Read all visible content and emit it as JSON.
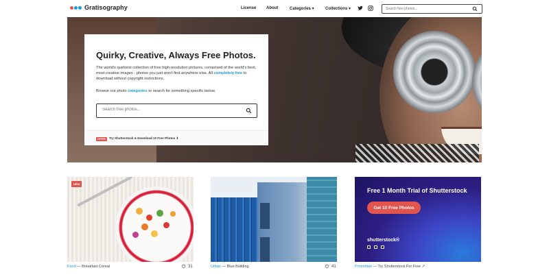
{
  "header": {
    "logo_text": "Gratisography",
    "nav": [
      {
        "label": "License"
      },
      {
        "label": "About"
      },
      {
        "label": "Categories ▾"
      },
      {
        "label": "Collections ▾"
      }
    ],
    "social_icons": [
      "twitter-icon",
      "instagram-icon"
    ],
    "search_placeholder": "Search free photos..."
  },
  "hero": {
    "title": "Quirky, Creative, Always Free Photos.",
    "desc_before": "The world's quirkiest collection of free high-resolution pictures, comprised of the world's best, most creative images - photos you just won't find anywhere else. All ",
    "desc_link": "completely free",
    "desc_after": " to download without copyright restrictions.",
    "browse_before": "Browse our photo ",
    "browse_link": "categories",
    "browse_after": " or search for something specific below.",
    "search_placeholder": "Search free photos...",
    "offer_badge": "OFFER",
    "offer_text": "Try Shutterstock & Download 10 Free Photos ⬇"
  },
  "cards": [
    {
      "badge": "NEW",
      "category": "Food",
      "title": " — Breakfast Cereal",
      "likes": "31"
    },
    {
      "category": "Urban",
      "title": " — Blue Building",
      "likes": "41"
    },
    {
      "category": "Promotion",
      "title": " — Try Shutterstock For Free ↗"
    }
  ],
  "ad": {
    "title": "Free 1 Month Trial of Shutterstock",
    "button": "Get 10 Free Photos",
    "logo": "shutterstock®"
  },
  "colors": {
    "accent": "#1a9be0",
    "offer_red": "#e2554e"
  }
}
